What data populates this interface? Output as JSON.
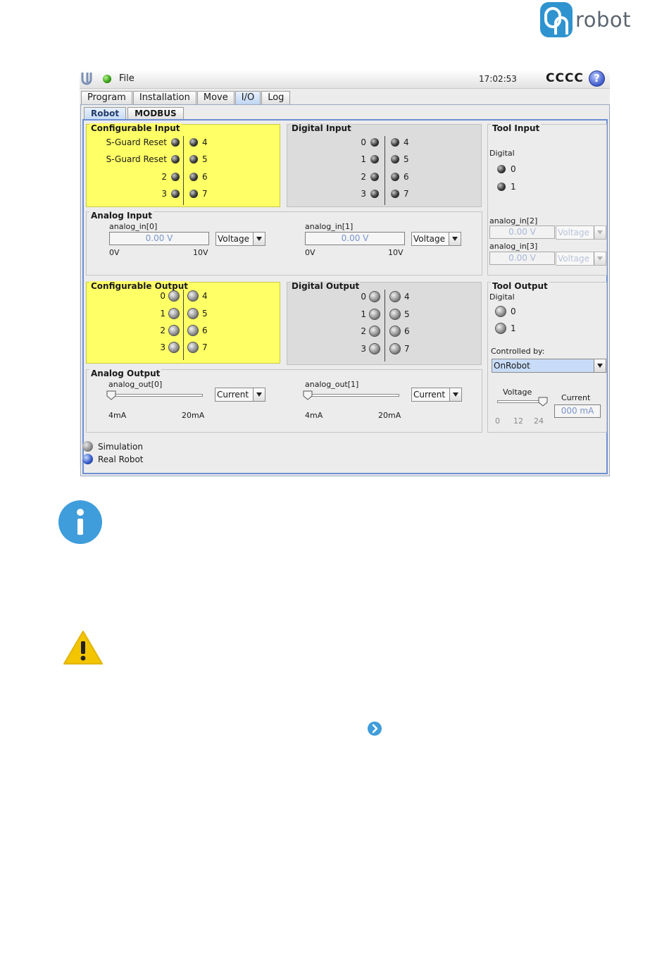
{
  "logo": {
    "text": "robot",
    "colors": {
      "badge": "#2f93cf",
      "text": "#5b6670"
    }
  },
  "topbar": {
    "file_label": "File",
    "time": "17:02:53",
    "robot_name": "CCCC",
    "help_glyph": "?"
  },
  "tabs": [
    {
      "label": "Program",
      "active": false
    },
    {
      "label": "Installation",
      "active": false
    },
    {
      "label": "Move",
      "active": false
    },
    {
      "label": "I/O",
      "active": true
    },
    {
      "label": "Log",
      "active": false
    }
  ],
  "subtabs": [
    {
      "label": "Robot",
      "active": true
    },
    {
      "label": "MODBUS",
      "active": false
    }
  ],
  "configurable_input": {
    "title": "Configurable Input",
    "left": [
      "S-Guard Reset",
      "S-Guard Reset",
      "2",
      "3"
    ],
    "right": [
      "4",
      "5",
      "6",
      "7"
    ]
  },
  "digital_input": {
    "title": "Digital Input",
    "left": [
      "0",
      "1",
      "2",
      "3"
    ],
    "right": [
      "4",
      "5",
      "6",
      "7"
    ]
  },
  "tool_input": {
    "title": "Tool Input",
    "digital_label": "Digital",
    "digital": [
      "0",
      "1"
    ],
    "analog": [
      {
        "label": "analog_in[2]",
        "value": "0.00 V",
        "mode": "Voltage"
      },
      {
        "label": "analog_in[3]",
        "value": "0.00 V",
        "mode": "Voltage"
      }
    ]
  },
  "analog_input": {
    "title": "Analog Input",
    "channels": [
      {
        "label": "analog_in[0]",
        "value": "0.00 V",
        "mode": "Voltage",
        "min": "0V",
        "max": "10V"
      },
      {
        "label": "analog_in[1]",
        "value": "0.00 V",
        "mode": "Voltage",
        "min": "0V",
        "max": "10V"
      }
    ]
  },
  "configurable_output": {
    "title": "Configurable Output",
    "left": [
      "0",
      "1",
      "2",
      "3"
    ],
    "right": [
      "4",
      "5",
      "6",
      "7"
    ]
  },
  "digital_output": {
    "title": "Digital Output",
    "left": [
      "0",
      "1",
      "2",
      "3"
    ],
    "right": [
      "4",
      "5",
      "6",
      "7"
    ]
  },
  "tool_output": {
    "title": "Tool Output",
    "digital_label": "Digital",
    "digital": [
      "0",
      "1"
    ],
    "controlled_by_label": "Controlled by:",
    "controlled_by": "OnRobot",
    "voltage_label": "Voltage",
    "voltage_ticks": [
      "0",
      "12",
      "24"
    ],
    "voltage_level_fraction": 1.0,
    "current_label": "Current",
    "current_value": "000 mA"
  },
  "analog_output": {
    "title": "Analog Output",
    "channels": [
      {
        "label": "analog_out[0]",
        "mode": "Current",
        "min": "4mA",
        "max": "20mA",
        "level_fraction": 0.0
      },
      {
        "label": "analog_out[1]",
        "mode": "Current",
        "min": "4mA",
        "max": "20mA",
        "level_fraction": 0.0
      }
    ]
  },
  "legend": {
    "simulation": "Simulation",
    "real_robot": "Real Robot"
  },
  "colors": {
    "configurable": "#ffff66",
    "digital_bg": "#dcdcdc",
    "selected_tab": "#c7dcf5",
    "accent_blue": "#3f9ddb",
    "warning": "#f2c500"
  }
}
